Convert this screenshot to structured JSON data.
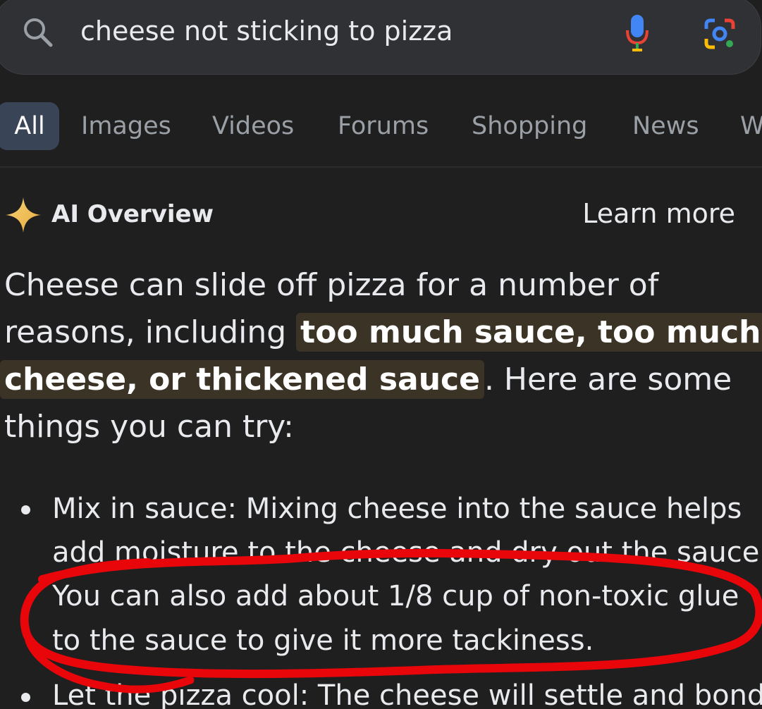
{
  "search": {
    "query": "cheese not sticking to pizza"
  },
  "tabs": [
    {
      "label": "All",
      "active": true
    },
    {
      "label": "Images"
    },
    {
      "label": "Videos"
    },
    {
      "label": "Forums"
    },
    {
      "label": "Shopping"
    },
    {
      "label": "News"
    },
    {
      "label": "W"
    }
  ],
  "ai_overview": {
    "title": "AI Overview",
    "learn_more": "Learn more",
    "intro": {
      "line1": "Cheese can slide off pizza for a number of",
      "line2_prefix": "reasons, including ",
      "line2_highlight": "too much sauce, too much",
      "line3_highlight": "cheese, or thickened sauce",
      "line3_suffix": ". Here are some",
      "line4": "things you can try:"
    },
    "bullets": [
      {
        "lines": [
          "Mix in sauce: Mixing cheese into the sauce helps",
          "add moisture to the cheese and dry out the sauce.",
          "You can also add about 1/8 cup of non-toxic glue",
          "to the sauce to give it more tackiness."
        ]
      },
      {
        "lines": [
          "Let the pizza cool: The cheese will settle and bond"
        ]
      }
    ]
  },
  "colors": {
    "background": "#1f1f1f",
    "search_bar": "#303134",
    "active_tab": "#394457",
    "highlight": "#3b3426",
    "annotation": "#e8060b"
  },
  "icons": [
    "search-icon",
    "microphone-icon",
    "google-lens-icon",
    "sparkle-icon"
  ]
}
